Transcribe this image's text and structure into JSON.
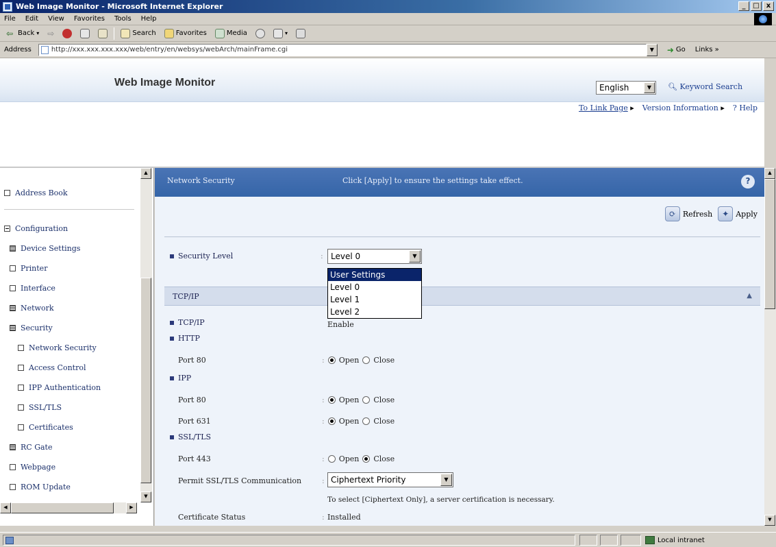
{
  "window": {
    "title": "Web Image Monitor - Microsoft Internet Explorer",
    "buttons": [
      "_",
      "□",
      "x"
    ]
  },
  "menubar": [
    "File",
    "Edit",
    "View",
    "Favorites",
    "Tools",
    "Help"
  ],
  "toolbar": {
    "back": "Back",
    "search": "Search",
    "favorites": "Favorites",
    "media": "Media"
  },
  "address": {
    "label": "Address",
    "url": "http://xxx.xxx.xxx.xxx/web/entry/en/websys/webArch/mainFrame.cgi",
    "go": "Go",
    "links": "Links"
  },
  "header": {
    "link_page": "To Link Page",
    "version_info": "Version Information",
    "help": "Help",
    "brand": "Web Image Monitor",
    "language": "English",
    "keyword_search": "Keyword Search"
  },
  "nav": {
    "items": [
      {
        "label": "Address Book"
      },
      {
        "label": "Configuration"
      },
      {
        "label": "Device Settings"
      },
      {
        "label": "Printer"
      },
      {
        "label": "Interface"
      },
      {
        "label": "Network"
      },
      {
        "label": "Security"
      },
      {
        "label": "Network Security"
      },
      {
        "label": "Access Control"
      },
      {
        "label": "IPP Authentication"
      },
      {
        "label": "SSL/TLS"
      },
      {
        "label": "Certificates"
      },
      {
        "label": "RC Gate"
      },
      {
        "label": "Webpage"
      },
      {
        "label": "ROM Update"
      }
    ]
  },
  "main": {
    "title": "Network Security",
    "message": "Click [Apply] to ensure the settings take effect.",
    "refresh": "Refresh",
    "apply": "Apply",
    "security_level_label": "Security Level",
    "security_level_value": "Level 0",
    "security_level_options": [
      "User Settings",
      "Level 0",
      "Level 1",
      "Level 2"
    ],
    "section_tcpip": "TCP/IP",
    "tcpip_label": "TCP/IP",
    "tcpip_value": "Enable",
    "http_label": "HTTP",
    "http_port": "Port 80",
    "ipp_label": "IPP",
    "ipp_port80": "Port 80",
    "ipp_port631": "Port 631",
    "ssl_label": "SSL/TLS",
    "ssl_port": "Port 443",
    "open": "Open",
    "close": "Close",
    "permit_label": "Permit SSL/TLS Communication",
    "permit_value": "Ciphertext Priority",
    "permit_note": "To select [Ciphertext Only], a server certification is necessary.",
    "cert_status_label": "Certificate Status",
    "cert_status_value": "Installed"
  },
  "status": {
    "zone": "Local intranet"
  }
}
